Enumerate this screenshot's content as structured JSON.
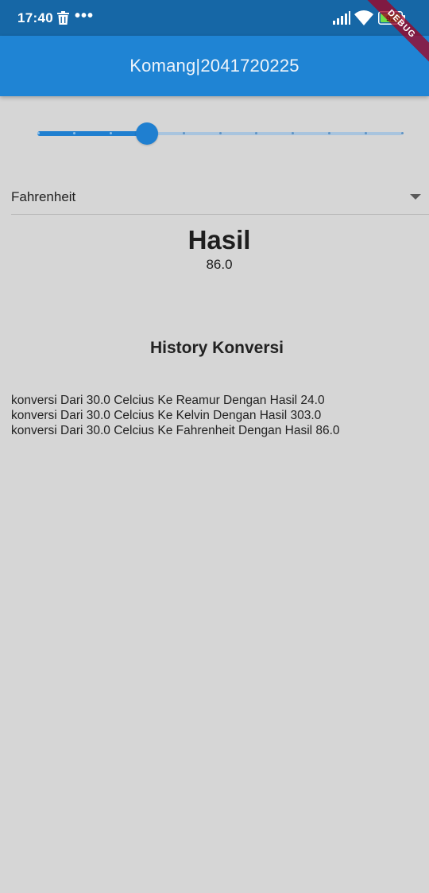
{
  "status_bar": {
    "time": "17:40",
    "overflow_dots": "•••",
    "battery_level": "92",
    "icons": [
      "trash-icon",
      "signal-icon",
      "wifi-icon",
      "battery-icon"
    ]
  },
  "debug_banner": {
    "label": "DEBUG"
  },
  "app_bar": {
    "title": "Komang|2041720225"
  },
  "slider": {
    "value": 30,
    "min": 0,
    "max": 100,
    "divisions": 10
  },
  "dropdown": {
    "selected": "Fahrenheit"
  },
  "result": {
    "title": "Hasil",
    "value": "86.0"
  },
  "history": {
    "title": "History Konversi",
    "items": [
      "konversi Dari 30.0 Celcius Ke Reamur Dengan Hasil 24.0",
      "konversi Dari 30.0 Celcius Ke Kelvin Dengan Hasil 303.0",
      "konversi Dari 30.0 Celcius Ke Fahrenheit Dengan Hasil 86.0"
    ]
  },
  "colors": {
    "status_bar": "#1667a6",
    "app_bar": "#1f84d4",
    "accent": "#1f7fd0",
    "background": "#d6d6d6"
  }
}
